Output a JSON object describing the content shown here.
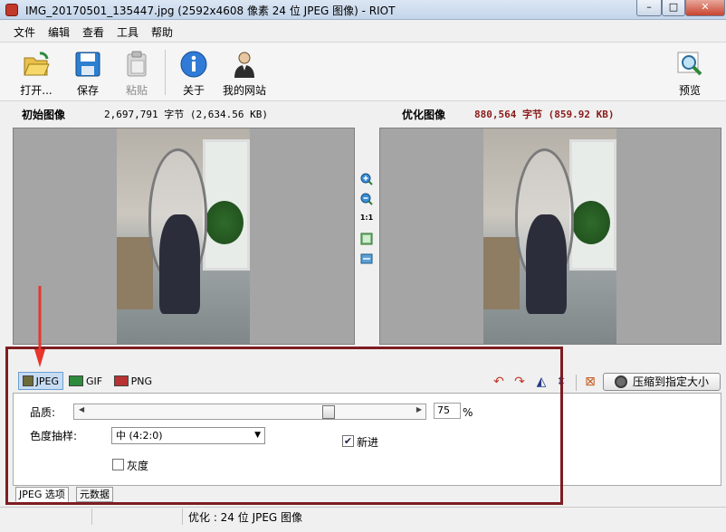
{
  "window": {
    "title": "IMG_20170501_135447.jpg (2592x4608 像素 24 位 JPEG 图像) - RIOT"
  },
  "menu": [
    "文件",
    "编辑",
    "查看",
    "工具",
    "帮助"
  ],
  "toolbar": {
    "open": "打开...",
    "save": "保存",
    "paste": "粘贴",
    "about": "关于",
    "website": "我的网站",
    "preview": "预览"
  },
  "info": {
    "original_label": "初始图像",
    "original_size": "2,697,791 字节 (2,634.56 KB)",
    "optimized_label": "优化图像",
    "optimized_size": "880,564 字节 (859.92 KB)"
  },
  "mid_tools": {
    "one_to_one": "1:1"
  },
  "formats": [
    "JPEG",
    "GIF",
    "PNG"
  ],
  "compress_button": "压缩到指定大小",
  "options": {
    "quality_label": "品质:",
    "quality_value": "75",
    "quality_unit": "%",
    "quality_level": 0.75,
    "subsampling_label": "色度抽样:",
    "subsampling_value": "中 (4:2:0)",
    "progressive_label": "新进",
    "progressive_checked": true,
    "grayscale_label": "灰度",
    "grayscale_checked": false
  },
  "bottom_tabs": [
    "JPEG 选项",
    "元数据"
  ],
  "status": {
    "text": "优化 : 24 位 JPEG 图像"
  },
  "colors": {
    "annotation_box": "#7d1d22",
    "annotation_arrow": "#e8362a",
    "optimized_size": "#8b1a1a"
  }
}
